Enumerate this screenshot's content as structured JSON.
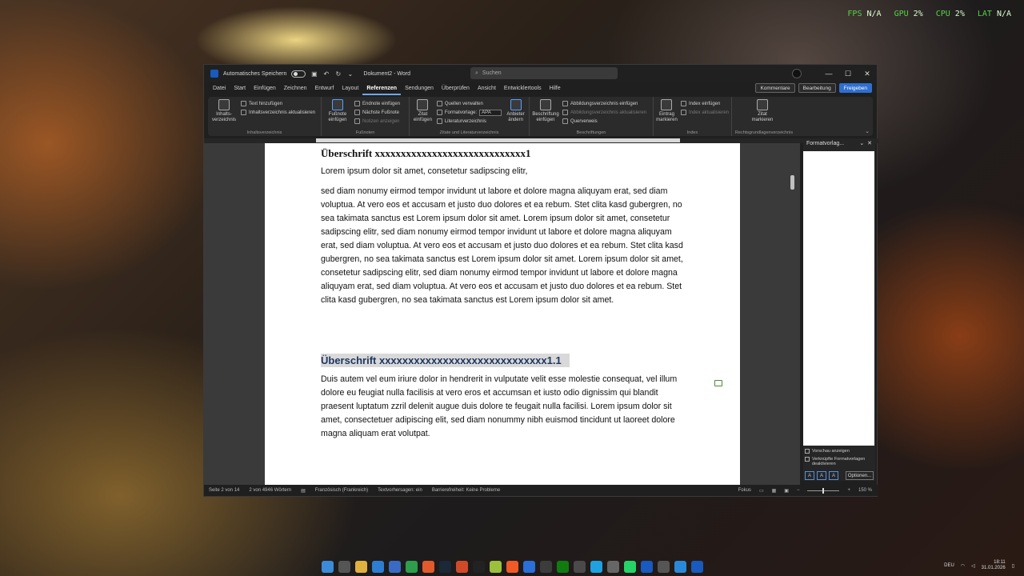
{
  "hud": {
    "fps_label": "FPS",
    "fps_value": "N/A",
    "gpu_label": "GPU",
    "gpu_value": "2%",
    "cpu_label": "CPU",
    "cpu_value": "2%",
    "lat_label": "LAT",
    "lat_value": "N/A"
  },
  "titlebar": {
    "autosave_label": "Automatisches Speichern",
    "doc_title": "Dokument2 - Word",
    "search_placeholder": "Suchen"
  },
  "tabs": [
    "Datei",
    "Start",
    "Einfügen",
    "Zeichnen",
    "Entwurf",
    "Layout",
    "Referenzen",
    "Sendungen",
    "Überprüfen",
    "Ansicht",
    "Entwicklertools",
    "Hilfe"
  ],
  "active_tab": "Referenzen",
  "tab_actions": {
    "comments": "Kommentare",
    "editing": "Bearbeitung",
    "share": "Freigeben"
  },
  "ribbon": {
    "toc": {
      "big": "Inhalts-verzeichnis",
      "add_text": "Text hinzufügen",
      "update": "Inhaltsverzeichnis aktualisieren",
      "label": "Inhaltsverzeichnis"
    },
    "footnotes": {
      "big": "Fußnote einfügen",
      "endnote": "Endnote einfügen",
      "next": "Nächste Fußnote",
      "show": "Notizen anzeigen",
      "label": "Fußnoten"
    },
    "citations": {
      "big": "Zitat einfügen",
      "sources": "Quellen verwalten",
      "style_label": "Formatvorlage:",
      "style_value": "APA",
      "bibliography": "Literaturverzeichnis",
      "search": "Anbieter ändern",
      "label": "Zitate und Literaturverzeichnis"
    },
    "captions": {
      "big": "Beschriftung einfügen",
      "table_figures": "Abbildungsverzeichnis einfügen",
      "update": "Abbildungsverzeichnis aktualisieren",
      "cross": "Querverweis",
      "label": "Beschriftungen"
    },
    "index": {
      "big": "Eintrag markieren",
      "insert": "Index einfügen",
      "update": "Index aktualisieren",
      "label": "Index"
    },
    "authorities": {
      "big": "Zitat markieren",
      "label": "Rechtsgrundlagenverzeichnis"
    }
  },
  "document": {
    "heading1": "Überschrift xxxxxxxxxxxxxxxxxxxxxxxxxxxxx1",
    "para1": "Lorem ipsum dolor sit amet, consetetur sadipscing elitr,",
    "para2": "sed diam nonumy eirmod tempor invidunt ut labore et dolore magna aliquyam erat, sed diam voluptua. At vero eos et accusam et justo duo dolores et ea rebum. Stet clita kasd gubergren, no sea takimata sanctus est Lorem ipsum dolor sit amet. Lorem ipsum dolor sit amet, consetetur sadipscing elitr, sed diam nonumy eirmod tempor invidunt ut labore et dolore magna aliquyam erat, sed diam voluptua. At vero eos et accusam et justo duo dolores et ea rebum. Stet clita kasd gubergren, no sea takimata sanctus est Lorem ipsum dolor sit amet. Lorem ipsum dolor sit amet, consetetur sadipscing elitr, sed diam nonumy eirmod tempor invidunt ut labore et dolore magna aliquyam erat, sed diam voluptua. At vero eos et accusam et justo duo dolores et ea rebum. Stet clita kasd gubergren, no sea takimata sanctus est Lorem ipsum dolor sit amet.",
    "heading2": "Überschrift xxxxxxxxxxxxxxxxxxxxxxxxxxxxx1.1",
    "para3": "Duis autem vel eum iriure dolor in hendrerit in vulputate velit esse molestie consequat, vel illum dolore eu feugiat nulla facilisis at vero eros et accumsan et iusto odio dignissim qui blandit praesent luptatum zzril delenit augue duis dolore te feugait nulla facilisi. Lorem ipsum dolor sit amet, consectetuer adipiscing elit, sed diam nonummy nibh euismod tincidunt ut laoreet dolore magna aliquam erat volutpat."
  },
  "pane": {
    "title": "Formatvorlag...",
    "preview": "Vorschau anzeigen",
    "linked": "Verknüpfte Formatvorlagen deaktivieren",
    "options": "Optionen..."
  },
  "status": {
    "page": "Seite 2 von 14",
    "words": "2 von 4946 Wörtern",
    "language": "Französisch (Frankreich)",
    "predictions": "Textvorhersagen: ein",
    "accessibility": "Barrierefreiheit: Keine Probleme",
    "focus": "Fokus",
    "zoom": "150 %"
  },
  "tray": {
    "lang": "DEU",
    "time": "18:11",
    "date": "31.01.2026"
  },
  "colors": {
    "accent": "#2f6fd2",
    "heading2": "#1f3763",
    "hud_green": "#57d24a"
  }
}
